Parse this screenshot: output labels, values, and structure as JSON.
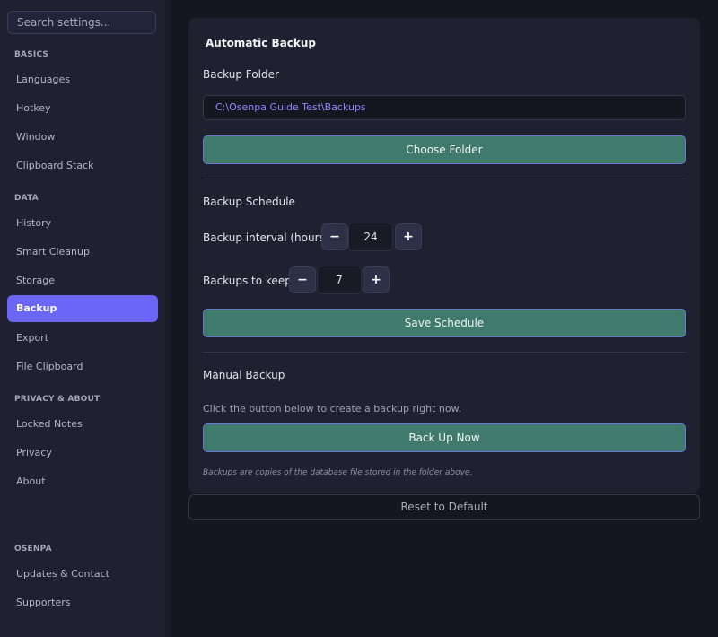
{
  "sidebar": {
    "search_placeholder": "Search settings...",
    "sections": {
      "basics": "BASICS",
      "data": "DATA",
      "privacy_about": "PRIVACY & ABOUT",
      "osenpa": "OSENPA"
    },
    "items": {
      "languages": "Languages",
      "hotkey": "Hotkey",
      "window": "Window",
      "clipboard_stack": "Clipboard Stack",
      "history": "History",
      "smart_cleanup": "Smart Cleanup",
      "storage": "Storage",
      "backup": "Backup",
      "export": "Export",
      "file_clipboard": "File Clipboard",
      "locked_notes": "Locked Notes",
      "privacy": "Privacy",
      "about": "About",
      "updates_contact": "Updates & Contact",
      "supporters": "Supporters"
    },
    "active_item": "Backup",
    "accent_color": "#6b66f6"
  },
  "panel": {
    "title": "Automatic Backup",
    "backup_folder_label": "Backup Folder",
    "backup_folder_value": "C:\\Osenpa Guide Test\\Backups",
    "choose_folder_label": "Choose Folder",
    "schedule_heading": "Backup Schedule",
    "interval_label": "Backup interval (hours)",
    "interval_value": "24",
    "keep_label": "Backups to keep",
    "keep_value": "7",
    "minus_symbol": "−",
    "plus_symbol": "+",
    "save_schedule_label": "Save Schedule",
    "manual_heading": "Manual Backup",
    "manual_hint": "Click the button below to create a backup right now.",
    "backup_now_label": "Back Up Now",
    "footnote": "Backups are copies of the database file stored in the folder above.",
    "button_color": "#3f7a6c"
  },
  "reset_label": "Reset to Default"
}
